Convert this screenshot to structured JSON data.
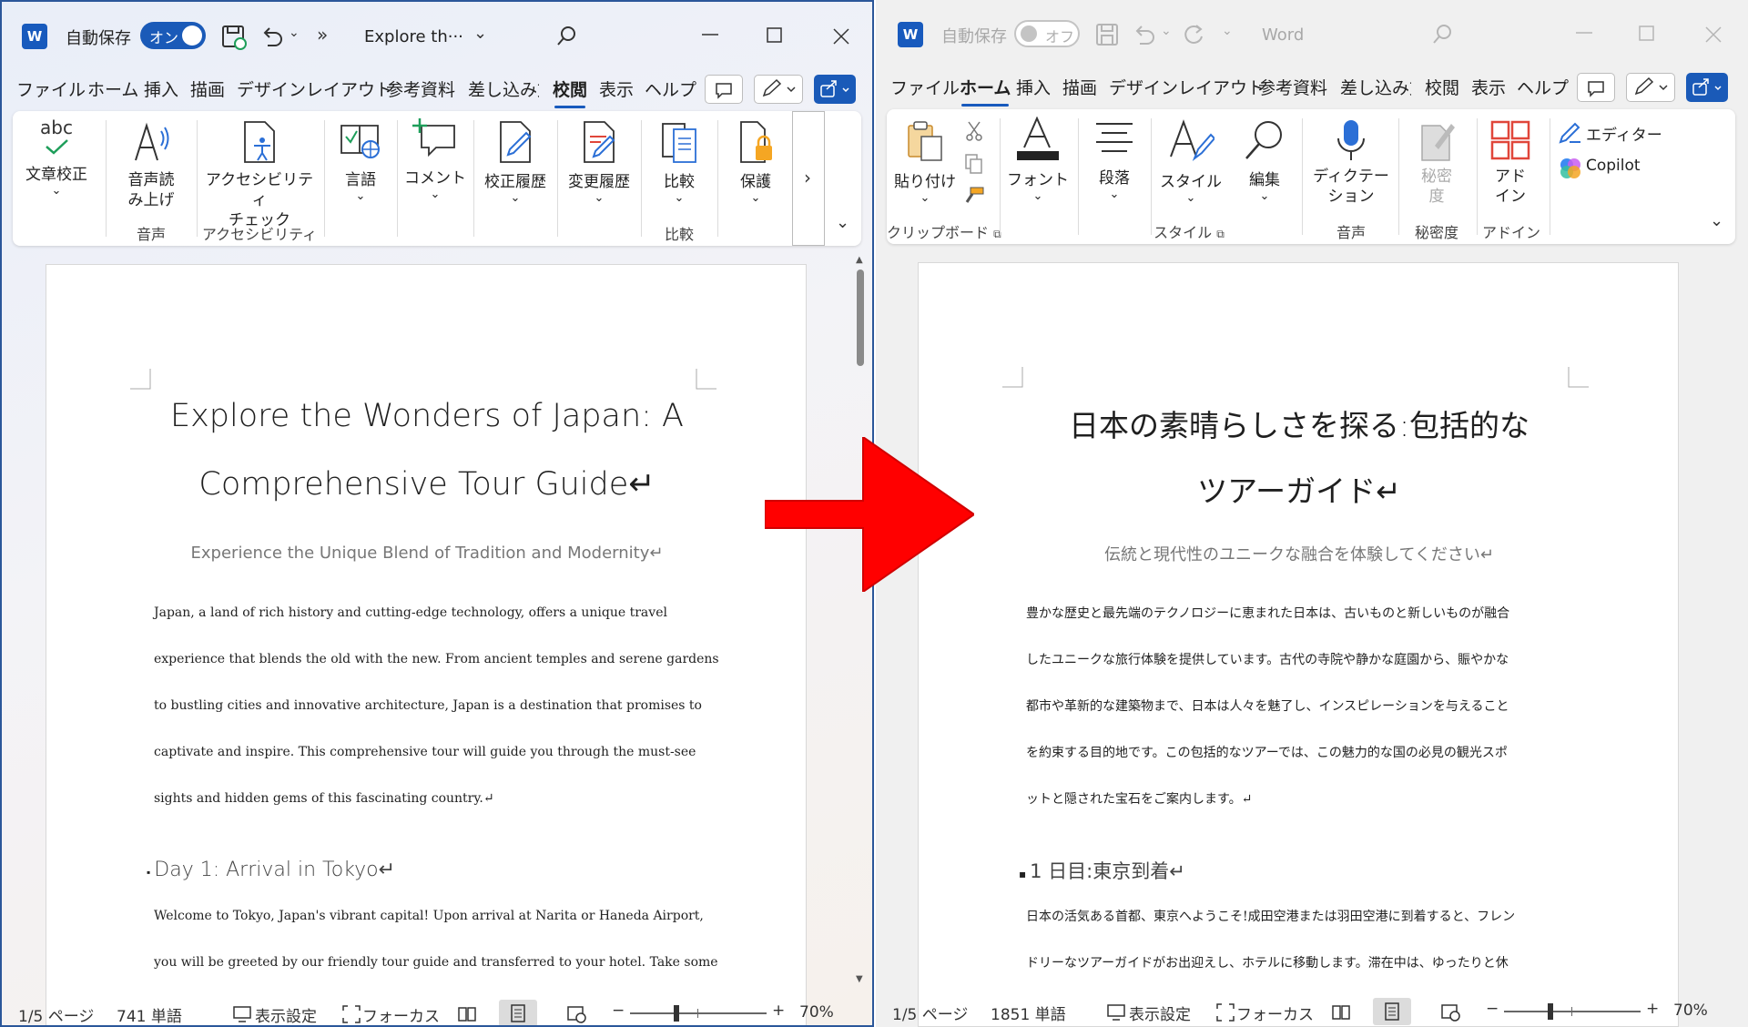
{
  "left": {
    "logo_letter": "W",
    "autosave_label": "自動保存",
    "autosave_state": "オン",
    "more": "»",
    "doc_title": "Explore th···",
    "menu": [
      "ファイル",
      "ホーム",
      "挿入",
      "描画",
      "デザイン",
      "レイアウト",
      "参考資料",
      "差し込み文",
      "校閲",
      "表示",
      "ヘルプ"
    ],
    "active_tab": "校閲",
    "ribbon": {
      "spelling": {
        "top": "abc",
        "label": "文章校正"
      },
      "read_aloud": "音声読\nみ上げ",
      "accessibility": "アクセシビリティ\nチェック",
      "language": "言語",
      "comment": "コメント",
      "track_changes": "校正履歴",
      "changes": "変更履歴",
      "compare": "比較",
      "protect": "保護",
      "more": "›",
      "groups": {
        "voice": "音声",
        "accessibility": "アクセシビリティ",
        "compare": "比較"
      }
    },
    "doc": {
      "title_line1": "Explore the Wonders of Japan: A",
      "title_line2": "Comprehensive Tour Guide↵",
      "subtitle": "Experience the Unique Blend of Tradition and Modernity↵",
      "para1": [
        "Japan, a land of rich history and cutting-edge technology, offers a unique travel",
        "experience that blends the old with the new. From ancient temples and serene gardens",
        "to bustling cities and innovative architecture, Japan is a destination that promises to",
        "captivate and inspire. This comprehensive tour will guide you through the must-see",
        "sights and hidden gems of this fascinating country.↵"
      ],
      "heading": "Day 1: Arrival in Tokyo↵",
      "para2": [
        "Welcome to Tokyo, Japan's vibrant capital! Upon arrival at Narita or Haneda Airport,",
        "you will be greeted by our friendly tour guide and transferred to your hotel. Take some"
      ]
    },
    "status": {
      "page": "1/5 ページ",
      "words": "741 単語",
      "display": "表示設定",
      "focus": "フォーカス",
      "zoom": "70%"
    }
  },
  "right": {
    "logo_letter": "W",
    "autosave_label": "自動保存",
    "autosave_state": "オフ",
    "doc_title": "Word",
    "menu": [
      "ファイル",
      "ホーム",
      "挿入",
      "描画",
      "デザイン",
      "レイアウト",
      "参考資料",
      "差し込み文",
      "校閲",
      "表示",
      "ヘルプ"
    ],
    "active_tab": "ホーム",
    "ribbon": {
      "paste": "貼り付け",
      "clipboard": "クリップボード",
      "font": "フォント",
      "paragraph": "段落",
      "styles": "スタイル",
      "style_group": "スタイル",
      "editing": "編集",
      "dictate": "ディクテー\nション",
      "voice": "音声",
      "sensitivity": "秘密\n度",
      "sensitivity_group": "秘密度",
      "addins": "アド\nイン",
      "addins_group": "アドイン",
      "editor": "エディター",
      "copilot": "Copilot"
    },
    "doc": {
      "title_line1": "日本の素晴らしさを探る:包括的な",
      "title_line2": "ツアーガイド↵",
      "subtitle": "伝統と現代性のユニークな融合を体験してください↵",
      "para1": [
        "豊かな歴史と最先端のテクノロジーに恵まれた日本は、古いものと新しいものが融合",
        "したユニークな旅行体験を提供しています。古代の寺院や静かな庭園から、賑やかな",
        "都市や革新的な建築物まで、日本は人々を魅了し、インスピレーションを与えること",
        "を約束する目的地です。この包括的なツアーでは、この魅力的な国の必見の観光スポ",
        "ットと隠された宝石をご案内します。↵"
      ],
      "heading": "1 日目:東京到着↵",
      "para2": [
        "日本の活気ある首都、東京へようこそ!成田空港または羽田空港に到着すると、フレン",
        "ドリーなツアーガイドがお出迎えし、ホテルに移動します。滞在中は、ゆったりと休"
      ]
    },
    "status": {
      "page": "1/5 ページ",
      "words": "1851 単語",
      "display": "表示設定",
      "focus": "フォーカス",
      "zoom": "70%"
    }
  },
  "colors": {
    "accent": "#185abd",
    "arrow": "#ff0000"
  }
}
